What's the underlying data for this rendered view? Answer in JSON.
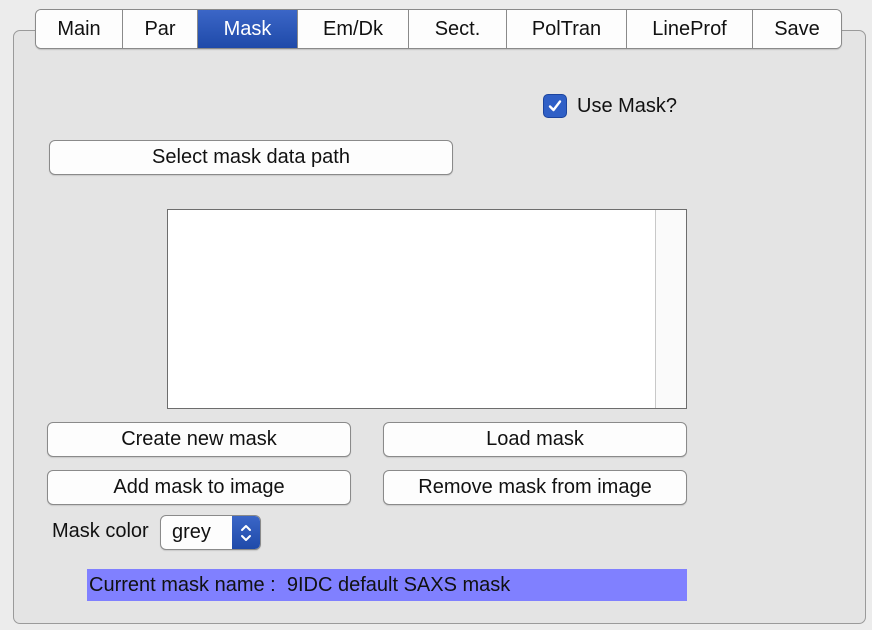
{
  "tabs": [
    {
      "label": "Main",
      "active": false
    },
    {
      "label": "Par",
      "active": false
    },
    {
      "label": "Mask",
      "active": true
    },
    {
      "label": "Em/Dk",
      "active": false
    },
    {
      "label": "Sect.",
      "active": false
    },
    {
      "label": "PolTran",
      "active": false
    },
    {
      "label": "LineProf",
      "active": false
    },
    {
      "label": "Save",
      "active": false
    }
  ],
  "use_mask": {
    "label": "Use Mask?",
    "checked": true
  },
  "buttons": {
    "select_path": "Select mask data path",
    "create_new": "Create new mask",
    "load": "Load mask",
    "add_to_image": "Add mask to image",
    "remove_from_image": "Remove mask from image"
  },
  "mask_color": {
    "label": "Mask color",
    "value": "grey"
  },
  "status": {
    "text": "Current mask name :  9IDC default SAXS mask"
  },
  "colors": {
    "accent": "#2f5fc6",
    "status_bg": "#8080ff"
  }
}
